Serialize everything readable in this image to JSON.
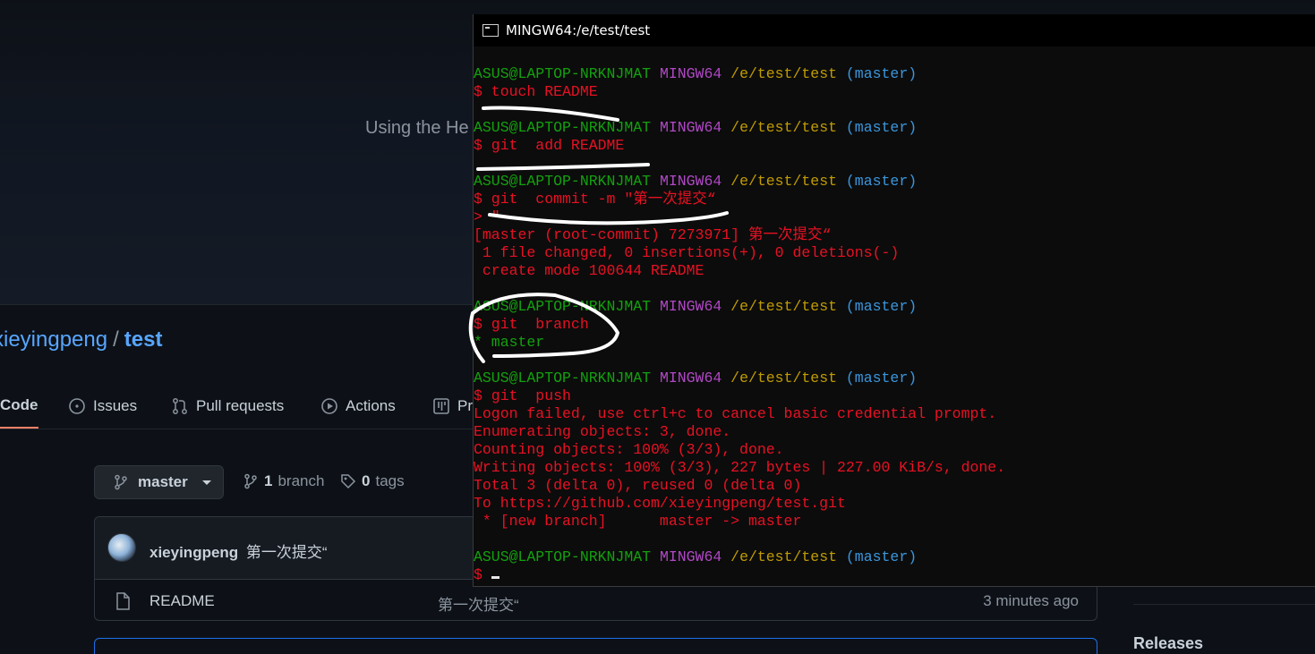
{
  "github": {
    "hero_text": "Using the He",
    "repo": {
      "owner": "xieyingpeng",
      "separator": "/",
      "name": "test"
    },
    "tabs": [
      {
        "label": "Code",
        "icon": "code-icon"
      },
      {
        "label": "Issues",
        "icon": "issue-icon"
      },
      {
        "label": "Pull requests",
        "icon": "pull-request-icon"
      },
      {
        "label": "Actions",
        "icon": "play-icon"
      },
      {
        "label": "Pr",
        "icon": "project-icon"
      }
    ],
    "branch_button": "master",
    "branches": {
      "count": "1",
      "label": "branch"
    },
    "tags": {
      "count": "0",
      "label": "tags"
    },
    "latest_commit": {
      "author": "xieyingpeng",
      "message": "第一次提交“"
    },
    "files": [
      {
        "name": "README",
        "commit": "第一次提交“",
        "time": "3 minutes ago"
      }
    ],
    "sidebar": {
      "releases": "Releases"
    }
  },
  "terminal": {
    "title": "MINGW64:/e/test/test",
    "prompt": {
      "user": "ASUS@LAPTOP-NRKNJMAT",
      "system": "MINGW64",
      "path": "/e/test/test",
      "branch": "(master)"
    },
    "lines": {
      "cmd_touch": "$ touch README",
      "cmd_add": "$ git  add README",
      "cmd_commit": "$ git  commit -m \"第一次提交“",
      "continuation": "> \"",
      "commit_out_1": "[master (root-commit) 7273971] 第一次提交“",
      "commit_out_2": " 1 file changed, 0 insertions(+), 0 deletions(-)",
      "commit_out_3": " create mode 100644 README",
      "cmd_branch": "$ git  branch",
      "branch_out": "* master",
      "cmd_push": "$ git  push",
      "push_out_1": "Logon failed, use ctrl+c to cancel basic credential prompt.",
      "push_out_2": "Enumerating objects: 3, done.",
      "push_out_3": "Counting objects: 100% (3/3), done.",
      "push_out_4": "Writing objects: 100% (3/3), 227 bytes | 227.00 KiB/s, done.",
      "push_out_5": "Total 3 (delta 0), reused 0 (delta 0)",
      "push_out_6": "To https://github.com/xieyingpeng/test.git",
      "push_out_7": " * [new branch]      master -> master",
      "final_prompt": "$ "
    }
  },
  "colors": {
    "github_bg": "#0d1117",
    "link_blue": "#58a6ff",
    "tab_underline": "#f78166",
    "term_green": "#13a10e",
    "term_magenta": "#b148c6",
    "term_yellow": "#c19c00",
    "term_cyan": "#3a96dd",
    "term_red": "#e81123"
  }
}
